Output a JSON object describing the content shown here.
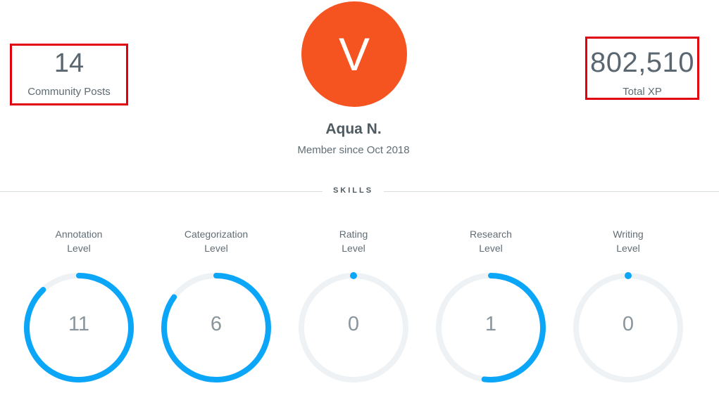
{
  "profile": {
    "avatar_initial": "V",
    "avatar_color": "#f55320",
    "name": "Aqua N.",
    "member_since": "Member since Oct 2018"
  },
  "stats": {
    "community_posts": {
      "value": "14",
      "label": "Community Posts"
    },
    "total_xp": {
      "value": "802,510",
      "label": "Total XP"
    }
  },
  "skills_heading": "SKILLS",
  "skills": [
    {
      "label_line1": "Annotation",
      "label_line2": "Level",
      "level": "11",
      "progress": 0.88
    },
    {
      "label_line1": "Categorization",
      "label_line2": "Level",
      "level": "6",
      "progress": 0.85
    },
    {
      "label_line1": "Rating",
      "label_line2": "Level",
      "level": "0",
      "progress": 0.0
    },
    {
      "label_line1": "Research",
      "label_line2": "Level",
      "level": "1",
      "progress": 0.52
    },
    {
      "label_line1": "Writing",
      "label_line2": "Level",
      "level": "0",
      "progress": 0.0
    }
  ],
  "colors": {
    "gauge_track": "#eef2f4",
    "gauge_fill": "#0ca6f9",
    "highlight_border": "#e0000f"
  }
}
